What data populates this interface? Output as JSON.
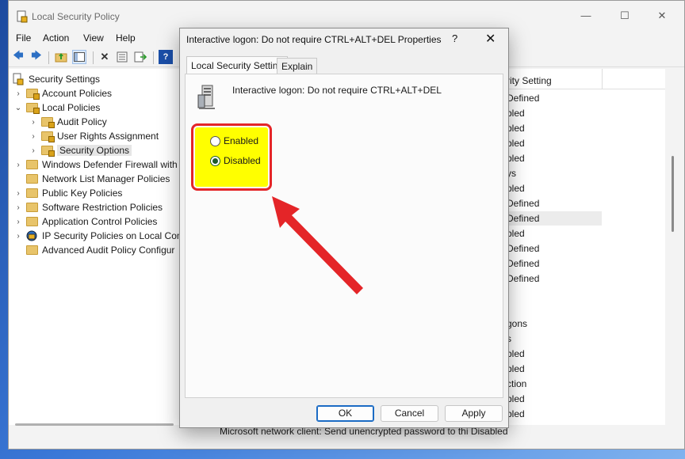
{
  "window": {
    "title": "Local Security Policy",
    "controls": {
      "minimize": "—",
      "maximize": "☐",
      "close": "✕"
    }
  },
  "menu": [
    "File",
    "Action",
    "View",
    "Help"
  ],
  "tree": {
    "root": "Security Settings",
    "items": [
      "Account Policies",
      "Local Policies",
      "Audit Policy",
      "User Rights Assignment",
      "Security Options",
      "Windows Defender Firewall with",
      "Network List Manager Policies",
      "Public Key Policies",
      "Software Restriction Policies",
      "Application Control Policies",
      "IP Security Policies on Local Com",
      "Advanced Audit Policy Configur"
    ]
  },
  "right_pane": {
    "header": "rity Setting",
    "rows": [
      "Defined",
      "bled",
      "bled",
      "bled",
      "bled",
      "ys",
      "bled",
      "Defined",
      "Defined",
      "bled",
      "Defined",
      "Defined",
      "Defined",
      "",
      "",
      "gons",
      "s",
      "bled",
      "bled",
      "ction",
      "bled",
      "bled"
    ]
  },
  "bottom_text": "Microsoft network client: Send unencrypted password to thi     Disabled",
  "dialog": {
    "title": "Interactive logon: Do not require CTRL+ALT+DEL Properties",
    "help": "?",
    "close": "✕",
    "tabs": [
      "Local Security Setting",
      "Explain"
    ],
    "policy_name": "Interactive logon: Do not require CTRL+ALT+DEL",
    "options": {
      "enabled": "Enabled",
      "disabled": "Disabled",
      "selected": "Disabled"
    },
    "buttons": {
      "ok": "OK",
      "cancel": "Cancel",
      "apply": "Apply"
    }
  },
  "colors": {
    "highlight": "#ffff00",
    "annotation": "#e42528",
    "accent": "#1b6bc4"
  }
}
